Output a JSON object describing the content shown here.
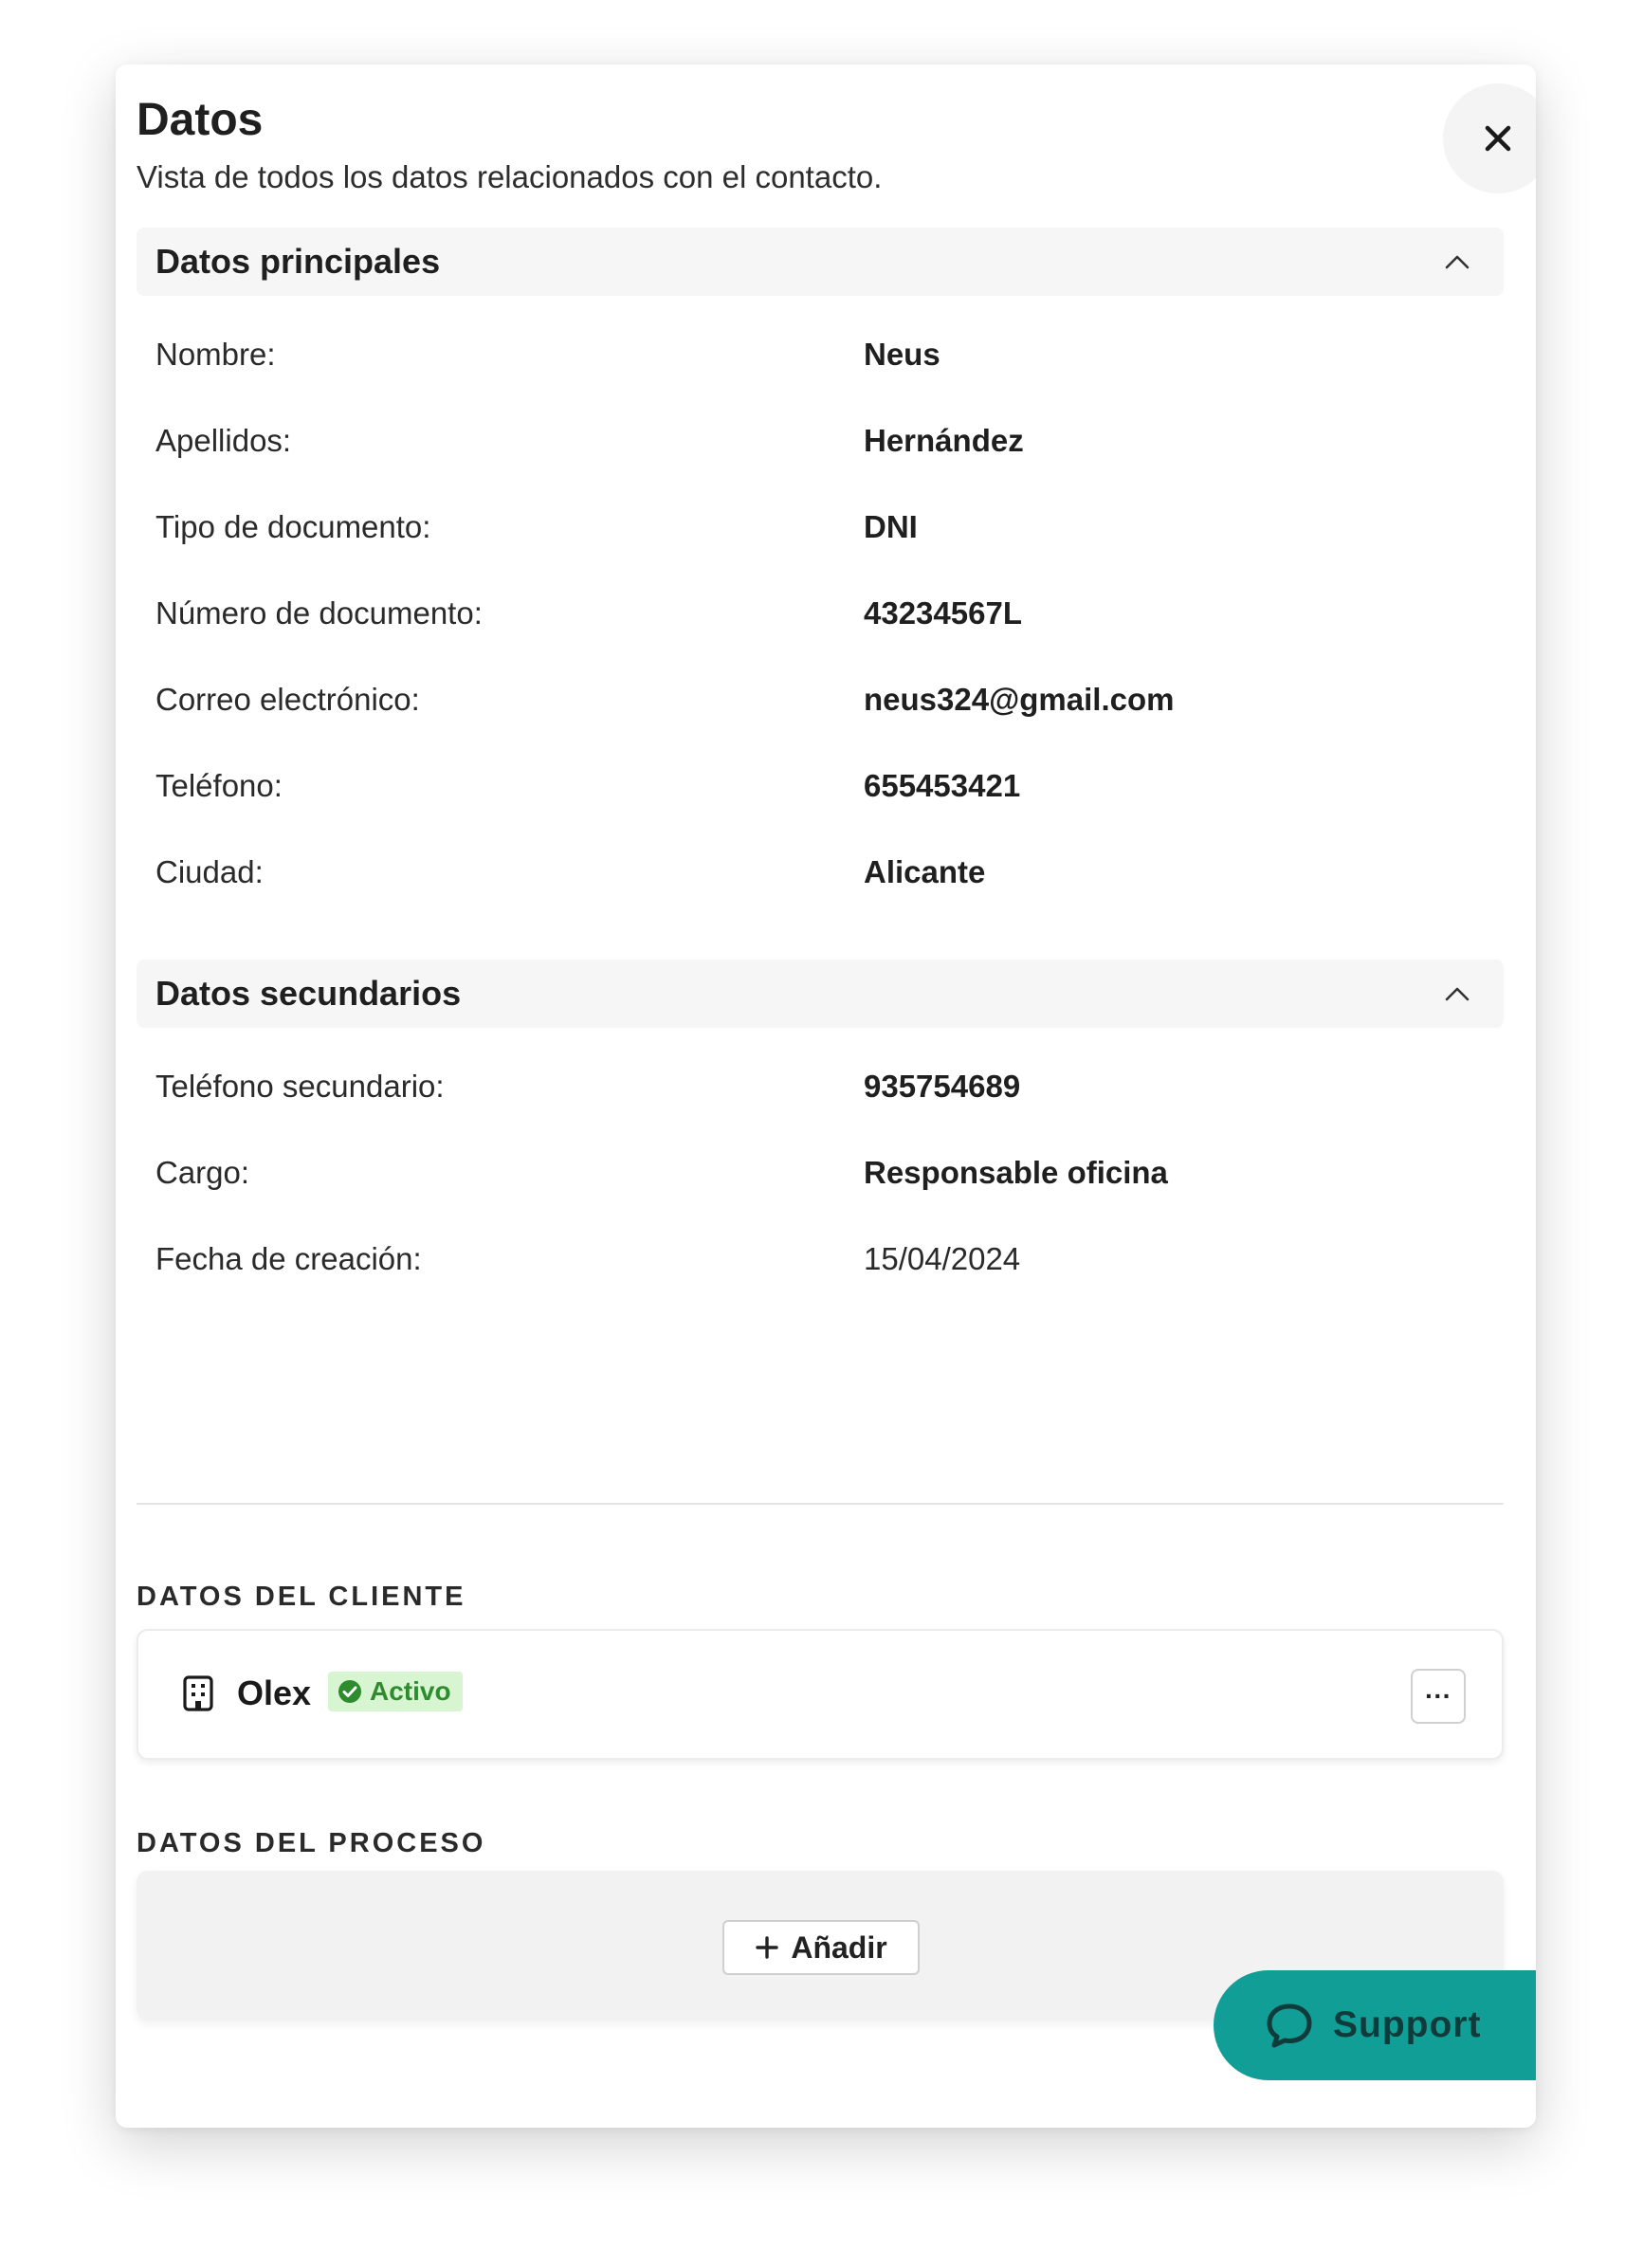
{
  "modal": {
    "title": "Datos",
    "subtitle": "Vista de todos los datos relacionados con el contacto."
  },
  "primary": {
    "title": "Datos principales",
    "rows": [
      {
        "label": "Nombre:",
        "value": "Neus"
      },
      {
        "label": "Apellidos:",
        "value": "Hernández"
      },
      {
        "label": "Tipo de documento:",
        "value": "DNI"
      },
      {
        "label": "Número de documento:",
        "value": "43234567L"
      },
      {
        "label": "Correo electrónico:",
        "value": "neus324@gmail.com"
      },
      {
        "label": "Teléfono:",
        "value": "655453421"
      },
      {
        "label": "Ciudad:",
        "value": "Alicante"
      }
    ]
  },
  "secondary": {
    "title": "Datos secundarios",
    "rows": [
      {
        "label": "Teléfono secundario:",
        "value": "935754689"
      },
      {
        "label": "Cargo:",
        "value": "Responsable oficina"
      },
      {
        "label": "Fecha de creación:",
        "value": "15/04/2024"
      }
    ]
  },
  "client": {
    "caption": "DATOS DEL CLIENTE",
    "name": "Olex",
    "status": "Activo",
    "more_label": "···"
  },
  "process": {
    "caption": "DATOS DEL PROCESO",
    "add_label": "Añadir"
  },
  "support": {
    "label": "Support"
  },
  "icons": {
    "close": "close-icon",
    "collapse": "chevron-up-icon",
    "building": "building-icon",
    "status": "check-circle-icon",
    "add": "plus-icon",
    "chat": "chat-bubble-icon"
  },
  "colors": {
    "accent": "#119e96",
    "status_bg": "#d8f5d2",
    "status_text": "#2e8b2e"
  }
}
